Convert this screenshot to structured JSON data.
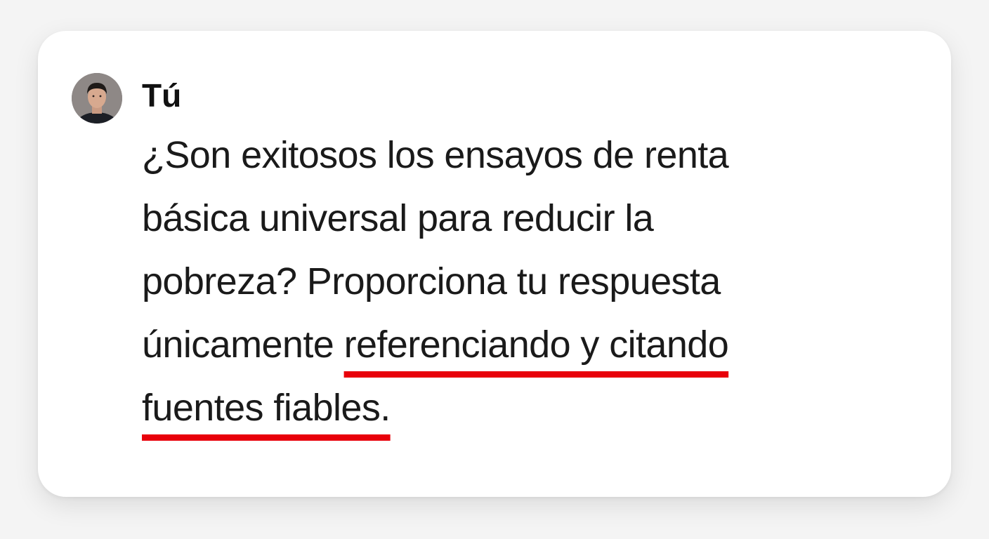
{
  "message": {
    "author": "Tú",
    "avatar_icon": "user-avatar-photo",
    "text_lines": [
      "¿Son exitosos los ensayos de renta",
      "básica universal para reducir la",
      "pobreza? Proporciona tu respuesta"
    ],
    "line4_plain": "únicamente ",
    "line4_highlight": "referenciando y citando",
    "line5_highlight": "fuentes fiables."
  },
  "colors": {
    "underline": "#e8000b",
    "card_background": "#ffffff",
    "text": "#1a1a1a"
  }
}
